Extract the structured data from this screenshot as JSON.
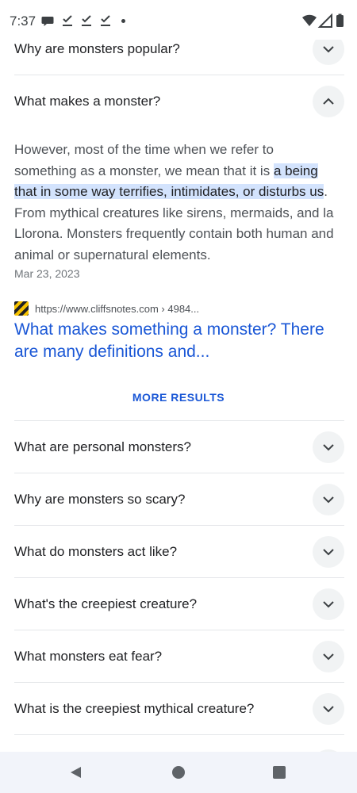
{
  "status_bar": {
    "time": "7:37"
  },
  "faq_top": [
    {
      "question": "Why are monsters popular?",
      "expanded": false
    },
    {
      "question": "What makes a monster?",
      "expanded": true
    }
  ],
  "answer": {
    "before": "However, most of the time when we refer to something as a monster, we mean that it is ",
    "highlight": "a being that in some way terrifies, intimidates, or disturbs us",
    "after": ". From mythical creatures like sirens, mermaids, and la Llorona. Monsters frequently contain both human and animal or supernatural elements.",
    "date": "Mar 23, 2023"
  },
  "source": {
    "url": "https://www.cliffsnotes.com › 4984...",
    "title": "What makes something a monster? There are many definitions and..."
  },
  "more_results": "MORE RESULTS",
  "faq_bottom": [
    {
      "question": "What are personal monsters?"
    },
    {
      "question": "Why are monsters so scary?"
    },
    {
      "question": "What do monsters act like?"
    },
    {
      "question": "What's the creepiest creature?"
    },
    {
      "question": "What monsters eat fear?"
    },
    {
      "question": "What is the creepiest mythical creature?"
    }
  ],
  "colors": {
    "link": "#1a57d6",
    "highlight": "#d3e3fd",
    "chevron_bg": "#f1f3f4",
    "navbar_bg": "#f2f4fa"
  },
  "icons": {
    "status": [
      "message-icon",
      "check-download-icon",
      "check-download-icon",
      "check-download-icon",
      "wifi-icon",
      "signal-icon",
      "battery-icon"
    ],
    "nav": [
      "back-icon",
      "home-icon",
      "recents-icon"
    ]
  }
}
